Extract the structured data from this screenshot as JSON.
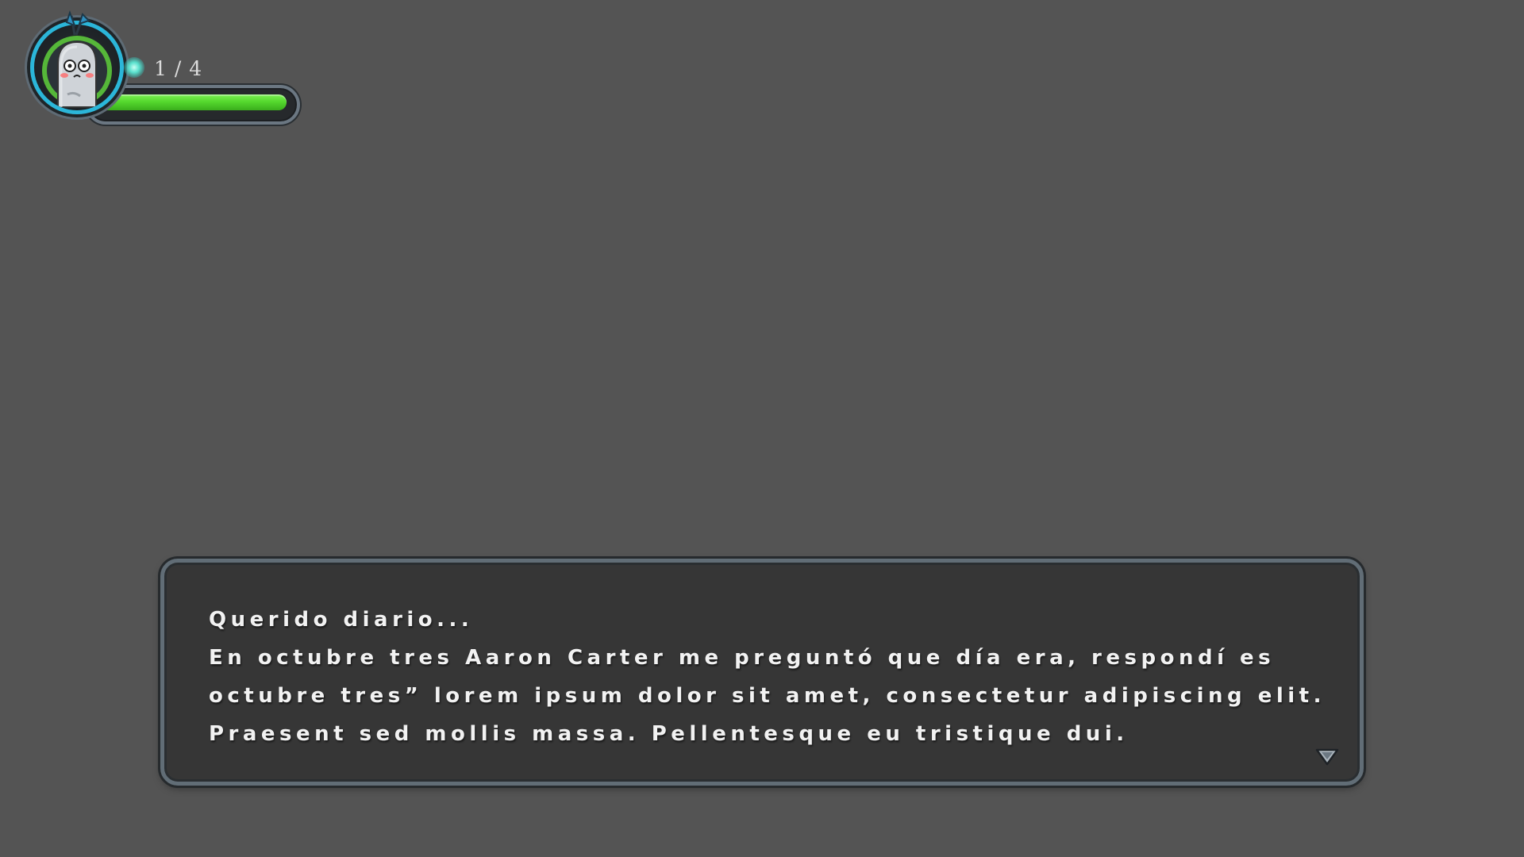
{
  "hud": {
    "collectible_counter": "1 / 4",
    "health_fraction": 0.97,
    "icons": {
      "portrait": "ghost-portrait-icon",
      "gem": "glowing-orb-icon"
    },
    "colors": {
      "health": "#55d92e",
      "portrait_ring": "#2bb6d9",
      "gem_glow": "#59e0cd"
    }
  },
  "dialogue": {
    "lines": [
      "Querido diario...",
      "En octubre tres Aaron Carter me preguntó que día era, respondí es",
      "octubre tres” lorem ipsum dolor sit amet, consectetur adipiscing elit.",
      "Praesent sed mollis massa. Pellentesque eu tristique dui."
    ],
    "continue_icon": "triangle-down-icon"
  },
  "colors": {
    "background": "#545454",
    "dialogue_bg": "#363636",
    "dialogue_border": "#616d76"
  }
}
